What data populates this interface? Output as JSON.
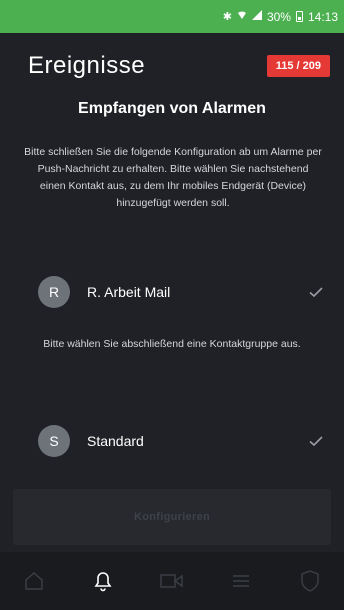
{
  "status_bar": {
    "icons": [
      "bluetooth-icon",
      "wifi-icon",
      "signal-icon",
      "battery-icon"
    ],
    "battery": "30%",
    "time": "14:13",
    "color": "#4caf50"
  },
  "header": {
    "title": "Ereignisse",
    "counter": "115 / 209",
    "counter_color": "#e53935"
  },
  "main": {
    "section_title": "Empfangen von Alarmen",
    "intro_text": "Bitte schließen Sie die folgende Konfiguration ab um Alarme per Push-Nachricht zu erhalten. Bitte wählen Sie nachstehend einen Kontakt aus, zu dem Ihr mobiles Endgerät (Device) hinzugefügt werden soll.",
    "contact": {
      "initial": "R",
      "name": "R. Arbeit Mail",
      "selected": true
    },
    "group_hint": "Bitte wählen Sie abschließend eine Kontaktgruppe aus.",
    "group": {
      "initial": "S",
      "name": "Standard",
      "selected": true
    },
    "configure_label": "Konfigurieren"
  },
  "bottom_nav": {
    "items": [
      "home-icon",
      "bell-icon",
      "video-icon",
      "menu-icon",
      "shield-icon"
    ],
    "active": "bell-icon"
  }
}
